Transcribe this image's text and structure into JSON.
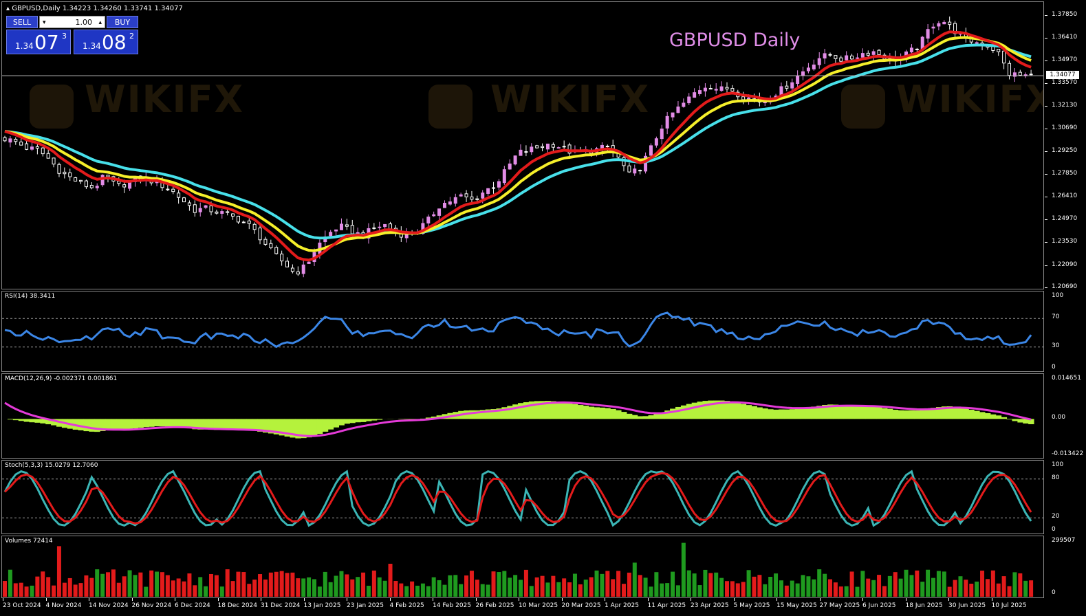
{
  "header": {
    "symbol_line": "▴ GBPUSD,Daily  1.34223 1.34260 1.33741 1.34077"
  },
  "one_click": {
    "sell_label": "SELL",
    "buy_label": "BUY",
    "lot_value": "1.00",
    "bid_small": "1.34",
    "bid_big": "07",
    "bid_sup": "3",
    "ask_small": "1.34",
    "ask_big": "08",
    "ask_sup": "2"
  },
  "chart_title": "GBPUSD Daily",
  "watermark_text": "WIKIFX",
  "current_price_tag": "1.34077",
  "price_axis": [
    "1.37850",
    "1.36410",
    "1.34970",
    "1.33570",
    "1.32130",
    "1.30690",
    "1.29250",
    "1.27850",
    "1.26410",
    "1.24970",
    "1.23530",
    "1.22090",
    "1.20690"
  ],
  "rsi": {
    "title": "RSI(14) 38.3411",
    "levels": [
      "100",
      "70",
      "30",
      "0"
    ]
  },
  "macd": {
    "title": "MACD(12,26,9) -0.002371 0.001861",
    "levels": [
      "0.014651",
      "0.00",
      "-0.013422"
    ]
  },
  "stoch": {
    "title": "Stoch(5,3,3) 15.0279 12.7060",
    "levels": [
      "100",
      "80",
      "20",
      "0"
    ]
  },
  "volumes": {
    "title": "Volumes 72414",
    "levels": [
      "299507",
      "0"
    ]
  },
  "date_axis": [
    "23 Oct 2024",
    "4 Nov 2024",
    "14 Nov 2024",
    "26 Nov 2024",
    "6 Dec 2024",
    "18 Dec 2024",
    "31 Dec 2024",
    "13 Jan 2025",
    "23 Jan 2025",
    "4 Feb 2025",
    "14 Feb 2025",
    "26 Feb 2025",
    "10 Mar 2025",
    "20 Mar 2025",
    "1 Apr 2025",
    "11 Apr 2025",
    "23 Apr 2025",
    "5 May 2025",
    "15 May 2025",
    "27 May 2025",
    "6 Jun 2025",
    "18 Jun 2025",
    "30 Jun 2025",
    "10 Jul 2025"
  ],
  "colors": {
    "bull_candle": "#e28ce6",
    "bear_candle": "#ffffff",
    "ma_fast": "#e31b1b",
    "ma_mid": "#f5ef2a",
    "ma_slow": "#48e0ea",
    "rsi_line": "#3b86e6",
    "macd_hist": "#b5f23c",
    "macd_signal": "#e43ad8",
    "stoch_main": "#3bb5b5",
    "stoch_signal": "#e31b1b",
    "volume_up": "#1f9a1f",
    "volume_down": "#e31b1b",
    "title_color": "#e08ee8"
  },
  "chart_data": {
    "type": "candlestick",
    "price_range": [
      1.2069,
      1.3785
    ],
    "close_path": [
      1.301,
      1.299,
      1.295,
      1.294,
      1.288,
      1.28,
      1.276,
      1.272,
      1.27,
      1.278,
      1.271,
      1.273,
      1.276,
      1.275,
      1.272,
      1.268,
      1.262,
      1.256,
      1.257,
      1.255,
      1.253,
      1.25,
      1.246,
      1.238,
      1.229,
      1.223,
      1.216,
      1.221,
      1.233,
      1.241,
      1.246,
      1.243,
      1.24,
      1.244,
      1.247,
      1.242,
      1.24,
      1.243,
      1.25,
      1.259,
      1.262,
      1.265,
      1.262,
      1.268,
      1.272,
      1.282,
      1.292,
      1.294,
      1.296,
      1.298,
      1.295,
      1.292,
      1.293,
      1.294,
      1.296,
      1.289,
      1.278,
      1.283,
      1.296,
      1.31,
      1.318,
      1.324,
      1.331,
      1.335,
      1.332,
      1.333,
      1.328,
      1.326,
      1.324,
      1.329,
      1.334,
      1.34,
      1.346,
      1.352,
      1.354,
      1.351,
      1.352,
      1.355,
      1.356,
      1.352,
      1.351,
      1.355,
      1.36,
      1.372,
      1.376,
      1.37,
      1.364,
      1.362,
      1.36,
      1.356,
      1.342,
      1.341,
      1.3408
    ]
  }
}
